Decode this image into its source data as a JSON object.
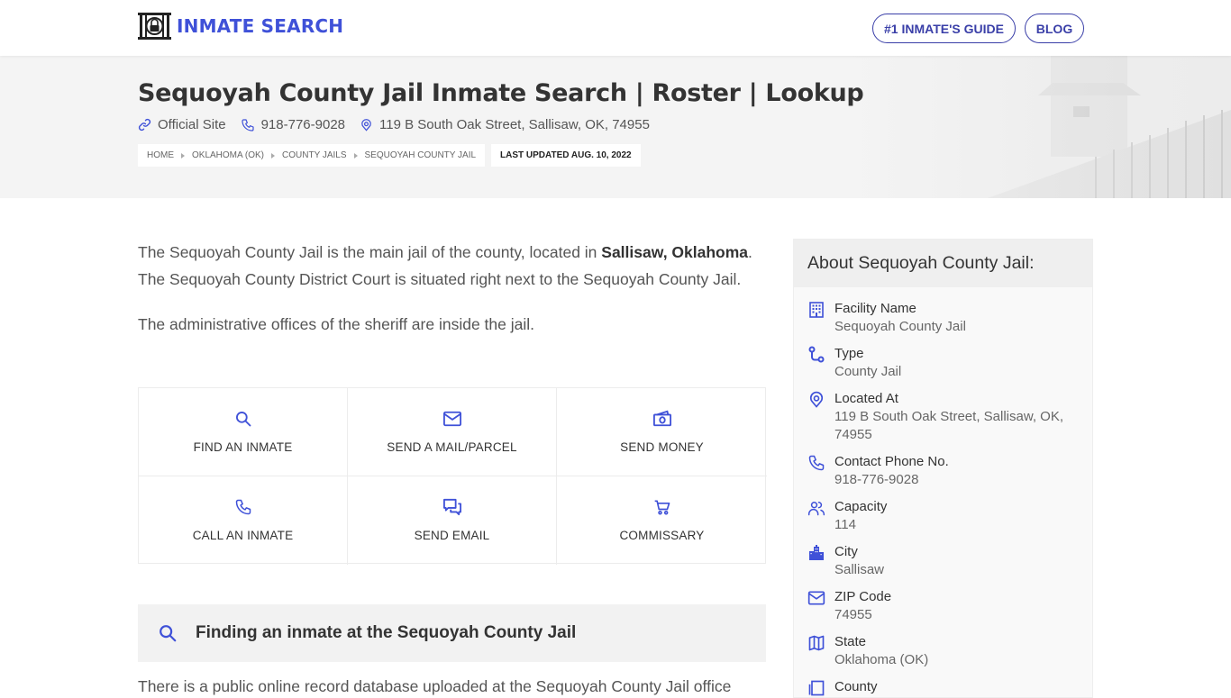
{
  "header": {
    "logo_text": "INMATE SEARCH",
    "nav": [
      {
        "label": "#1 INMATE'S GUIDE"
      },
      {
        "label": "BLOG"
      }
    ]
  },
  "hero": {
    "title": "Sequoyah County Jail Inmate Search | Roster | Lookup",
    "official_site": "Official Site",
    "phone": "918-776-9028",
    "address": "119 B South Oak Street, Sallisaw, OK, 74955",
    "breadcrumbs": [
      "HOME",
      "OKLAHOMA (OK)",
      "COUNTY JAILS",
      "SEQUOYAH COUNTY JAIL"
    ],
    "last_updated": "LAST UPDATED AUG. 10, 2022"
  },
  "intro": {
    "p1_before": "The Sequoyah County Jail is the main jail of the county, located in ",
    "p1_bold": "Sallisaw, Oklahoma",
    "p1_after": ". The Sequoyah County District Court is situated right next to the Sequoyah County Jail.",
    "p2": "The administrative offices of the sheriff are inside the jail."
  },
  "actions": [
    {
      "label": "FIND AN INMATE",
      "icon": "search-icon"
    },
    {
      "label": "SEND A MAIL/PARCEL",
      "icon": "mail-icon"
    },
    {
      "label": "SEND MONEY",
      "icon": "money-icon"
    },
    {
      "label": "CALL AN INMATE",
      "icon": "phone-icon"
    },
    {
      "label": "SEND EMAIL",
      "icon": "chat-icon"
    },
    {
      "label": "COMMISSARY",
      "icon": "cart-icon"
    }
  ],
  "find_section": {
    "title": "Finding an inmate at the Sequoyah County Jail",
    "text": "There is a public online record database uploaded at the Sequoyah County Jail office"
  },
  "sidebar": {
    "title": "About Sequoyah County Jail:",
    "items": [
      {
        "label": "Facility Name",
        "value": "Sequoyah County Jail",
        "icon": "building-icon"
      },
      {
        "label": "Type",
        "value": "County Jail",
        "icon": "route-icon"
      },
      {
        "label": "Located At",
        "value": "119 B South Oak Street, Sallisaw, OK, 74955",
        "icon": "location-pin-icon"
      },
      {
        "label": "Contact Phone No.",
        "value": "918-776-9028",
        "icon": "phone-icon"
      },
      {
        "label": "Capacity",
        "value": "114",
        "icon": "users-icon"
      },
      {
        "label": "City",
        "value": "Sallisaw",
        "icon": "city-icon"
      },
      {
        "label": "ZIP Code",
        "value": "74955",
        "icon": "mail-icon"
      },
      {
        "label": "State",
        "value": "Oklahoma (OK)",
        "icon": "map-icon"
      },
      {
        "label": "County",
        "value": "",
        "icon": "county-icon"
      }
    ]
  },
  "colors": {
    "accent": "#3f51d8",
    "nav_border": "#3a3fa8",
    "hero_bg": "#f4f4f4"
  }
}
